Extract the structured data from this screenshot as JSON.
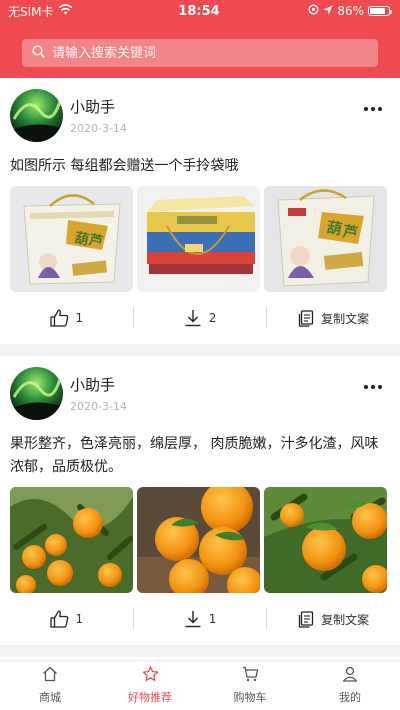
{
  "status_bar": {
    "carrier": "无SIM卡",
    "time": "18:54",
    "battery": "86%",
    "battery_level": 0.86
  },
  "search": {
    "placeholder": "请输入搜索关键词"
  },
  "posts": [
    {
      "author": "小助手",
      "date": "2020-3-14",
      "text": "如图所示 每组都会赠送一个手拎袋哦",
      "likes": "1",
      "downloads": "2",
      "copy_label": "复制文案"
    },
    {
      "author": "小助手",
      "date": "2020-3-14",
      "text": "果形整齐，色泽亮丽，绵层厚， 肉质脆嫩，汁多化渣，风味浓郁，品质极优。",
      "likes": "1",
      "downloads": "1",
      "copy_label": "复制文案"
    }
  ],
  "tabbar": {
    "items": [
      {
        "label": "商城"
      },
      {
        "label": "好物推荐"
      },
      {
        "label": "购物车"
      },
      {
        "label": "我的"
      }
    ],
    "active_color": "#ee4a50"
  },
  "colors": {
    "brand": "#ee4a50"
  }
}
